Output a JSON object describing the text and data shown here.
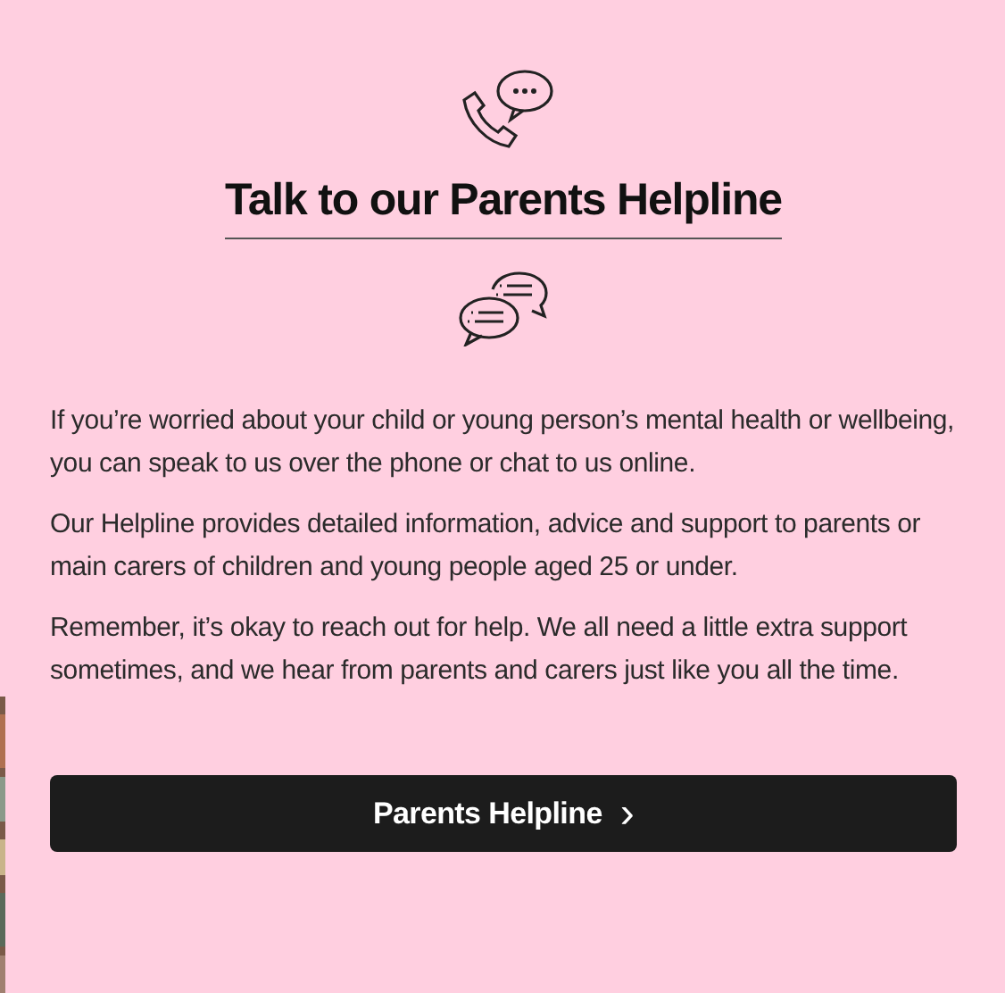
{
  "heading": "Talk to our Parents Helpline",
  "paragraphs": [
    "If you’re worried about your child or young person’s mental health or wellbeing, you can speak to us over the phone or chat to us online.",
    "Our Helpline provides detailed information, advice and support to parents or main carers of children and young people aged 25 or under.",
    "Remember, it’s okay to reach out for help. We all need a little extra support sometimes, and we hear from parents and carers just like you all the time."
  ],
  "button": {
    "label": "Parents Helpline",
    "chevron": "›"
  }
}
